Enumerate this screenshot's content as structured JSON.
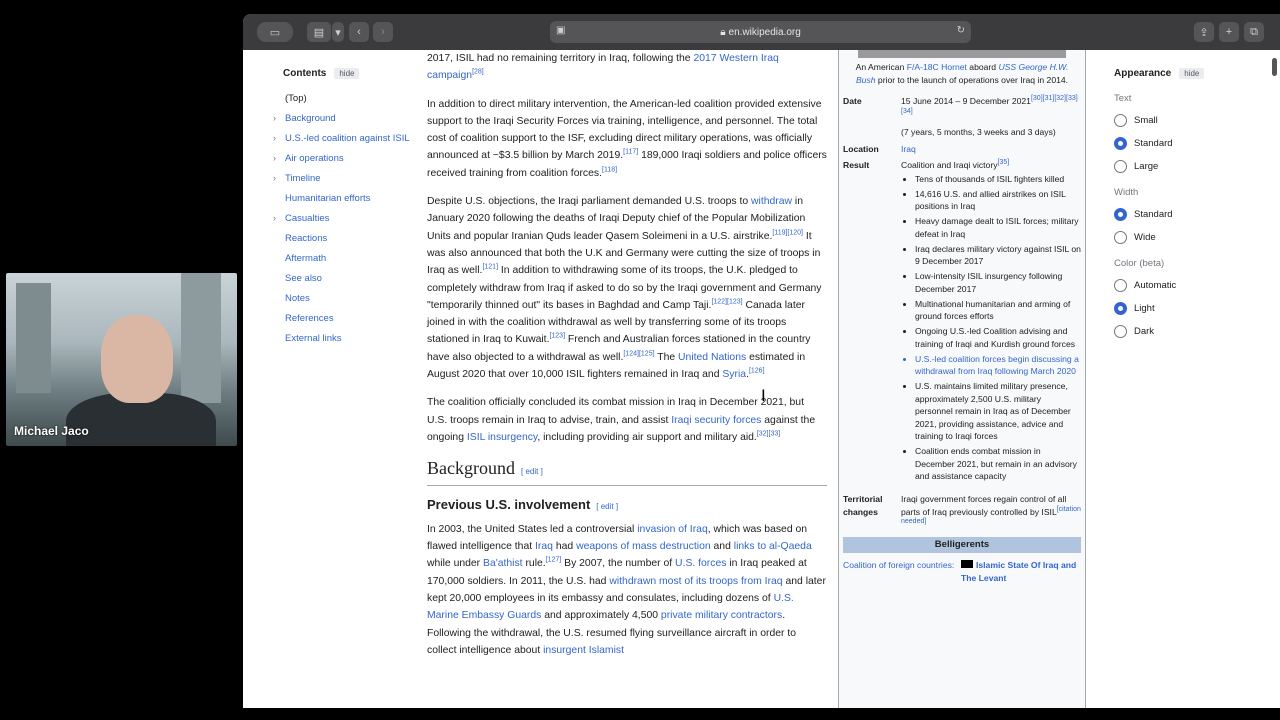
{
  "webcam": {
    "participant_name": "Michael Jaco"
  },
  "browser": {
    "url": "en.wikipedia.org",
    "toolbar_icons": [
      "sidebar-icon",
      "chevron-down-icon",
      "back-icon",
      "forward-icon",
      "lock-icon",
      "reload-icon",
      "share-icon",
      "new-tab-icon",
      "tabs-icon"
    ]
  },
  "toc": {
    "title": "Contents",
    "hide_label": "hide",
    "items": [
      "(Top)",
      "Background",
      "U.S.-led coalition against ISIL",
      "Air operations",
      "Timeline",
      "Humanitarian efforts",
      "Casualties",
      "Reactions",
      "Aftermath",
      "See also",
      "Notes",
      "References",
      "External links"
    ]
  },
  "article": {
    "p1": {
      "text": "2017, ISIL had no remaining territory in Iraq, following the ",
      "link": "2017 Western Iraq campaign",
      "ref": "[28]"
    },
    "p2": {
      "text": "In addition to direct military intervention, the American-led coalition provided extensive support to the Iraqi Security Forces via training, intelligence, and personnel. The total cost of coalition support to the ISF, excluding direct military operations, was officially announced at ~$3.5 billion by March 2019.",
      "ref1": "[117]",
      "text2": " 189,000 Iraqi soldiers and police officers received training from coalition forces.",
      "ref2": "[118]"
    },
    "p3": {
      "a": "Despite U.S. objections, the Iraqi parliament demanded U.S. troops to ",
      "link_withdraw": "withdraw",
      "b": " in January 2020 following the deaths of Iraqi Deputy chief of the Popular Mobilization Units and popular Iranian Quds leader Qasem Soleimeni in a U.S. airstrike.",
      "ref_a": "[119][120]",
      "c": " It was also announced that both the U.K and Germany were cutting the size of troops in Iraq as well.",
      "ref_b": "[121]",
      "d": " In addition to withdrawing some of its troops, the U.K. pledged to completely withdraw from Iraq if asked to do so by the Iraqi government and Germany \"temporarily thinned out\" its bases in Baghdad and Camp Taji.",
      "ref_c": "[122][123]",
      "e": " Canada later joined in with the coalition withdrawal as well by transferring some of its troops stationed in Iraq to Kuwait.",
      "ref_d": "[123]",
      "f": " French and Australian forces stationed in the country have also objected to a withdrawal as well.",
      "ref_e": "[124][125]",
      "g": " The ",
      "link_un": "United Nations",
      "h": " estimated in August 2020 that over 10,000 ISIL fighters remained in Iraq and ",
      "link_syria": "Syria",
      "i": ".",
      "ref_f": "[126]"
    },
    "p4": {
      "a": "The coalition officially concluded its combat mission in Iraq in December 2021, but U.S. troops remain in Iraq to advise, train, and assist ",
      "link_isf": "Iraqi security forces",
      "b": " against the ongoing ",
      "link_ins": "ISIL insurgency",
      "c": ", including providing air support and military aid.",
      "ref": "[32][33]"
    },
    "h2_background": "Background",
    "h3_previous": "Previous U.S. involvement",
    "edit_label": "edit",
    "p5": {
      "a": "In 2003, the United States led a controversial ",
      "l1": "invasion of Iraq",
      "b": ", which was based on flawed intelligence that ",
      "l2": "Iraq",
      "c": " had ",
      "l3": "weapons of mass destruction",
      "d": " and ",
      "l4": "links to al-Qaeda",
      "e": " while under ",
      "l5": "Ba'athist",
      "f": " rule.",
      "ref1": "[127]",
      "g": " By 2007, the number of ",
      "l6": "U.S. forces",
      "h": " in Iraq peaked at 170,000 soldiers. In 2011, the U.S. had ",
      "l7": "withdrawn most of its troops from Iraq",
      "i": " and later kept 20,000 employees in its embassy and consulates, including dozens of ",
      "l8": "U.S. Marine Embassy Guards",
      "j": " and approximately 4,500 ",
      "l9": "private military contractors",
      "k": ". Following the withdrawal, the U.S. resumed flying surveillance aircraft in order to collect intelligence about ",
      "l10": "insurgent Islamist"
    }
  },
  "infobox": {
    "caption_a": "An American ",
    "caption_link1": "F/A-18C Hornet",
    "caption_b": " aboard ",
    "caption_link2": "USS George H.W. Bush",
    "caption_c": " prior to the launch of operations over Iraq in 2014.",
    "date_label": "Date",
    "date_value": "15 June 2014 – 9 December 2021",
    "date_refs": "[30][31][32][33][34]",
    "duration": "(7 years, 5 months, 3 weeks and 3 days)",
    "location_label": "Location",
    "location_value": "Iraq",
    "result_label": "Result",
    "result_value": "Coalition and Iraqi victory",
    "result_ref": "[35]",
    "results": [
      "Tens of thousands of ISIL fighters killed",
      "14,616 U.S. and allied airstrikes on ISIL positions in Iraq",
      "Heavy damage dealt to ISIL forces; military defeat in Iraq",
      "Iraq declares military victory against ISIL on 9 December 2017",
      "Low-intensity ISIL insurgency following December 2017",
      "Multinational humanitarian and arming of ground forces efforts",
      "Ongoing U.S.-led Coalition advising and training of Iraqi and Kurdish ground forces",
      "U.S.-led coalition forces begin discussing a withdrawal from Iraq following March 2020",
      "U.S. maintains limited military presence, approximately 2,500 U.S. military personnel remain in Iraq as of December 2021, providing assistance, advice and training to Iraqi forces",
      "Coalition ends combat mission in December 2021, but remain in an advisory and assistance capacity"
    ],
    "territorial_label": "Territorial changes",
    "territorial_value": "Iraqi government forces regain control of all parts of Iraq previously controlled by ISIL",
    "territorial_ref": "[citation needed]",
    "belligerents_label": "Belligerents",
    "coalition_label": "Coalition of foreign countries:",
    "isil_label": "Islamic State Of Iraq and The Levant"
  },
  "appearance": {
    "title": "Appearance",
    "hide_label": "hide",
    "text_label": "Text",
    "text_options": [
      "Small",
      "Standard",
      "Large"
    ],
    "text_selected": "Standard",
    "width_label": "Width",
    "width_options": [
      "Standard",
      "Wide"
    ],
    "width_selected": "Standard",
    "color_label": "Color (beta)",
    "color_options": [
      "Automatic",
      "Light",
      "Dark"
    ],
    "color_selected": "Light"
  }
}
